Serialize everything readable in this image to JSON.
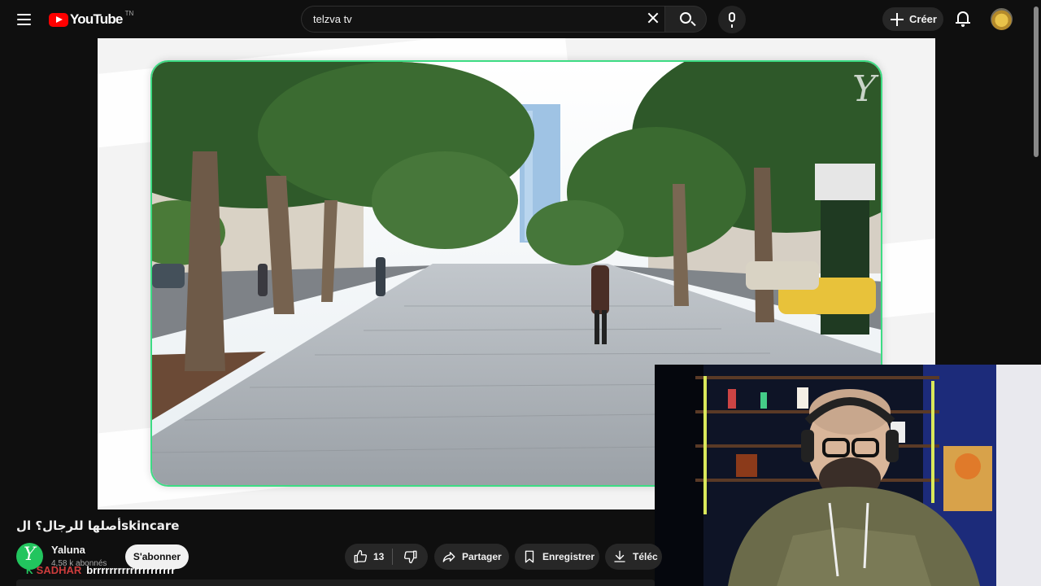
{
  "header": {
    "logo_text": "YouTube",
    "country_code": "TN",
    "search_query": "telzva tv",
    "create_label": "Créer",
    "icons": [
      "menu-icon",
      "youtube-logo",
      "close-icon",
      "search-icon",
      "mic-icon",
      "plus-icon",
      "bell-icon",
      "avatar"
    ]
  },
  "player": {
    "watermark": "Y"
  },
  "video": {
    "title": "أصلها للرجال؟ الskincare",
    "channel": {
      "name": "Yaluna",
      "subscribers": "4,58 k abonnés",
      "avatar_letter": "Y"
    },
    "subscribe_label": "S'abonner",
    "actions": {
      "like_count": "13",
      "share_label": "Partager",
      "save_label": "Enregistrer",
      "download_label": "Téléc"
    }
  },
  "chat_overlay": {
    "badge": "K",
    "user": "SADHAR",
    "message": "brrrrrrrrrrrrrrrrrrrr"
  },
  "colors": {
    "background": "#0f0f0f",
    "brand_red": "#ff0000",
    "frame_green": "#3ddc84",
    "channel_green": "#22c55e"
  }
}
